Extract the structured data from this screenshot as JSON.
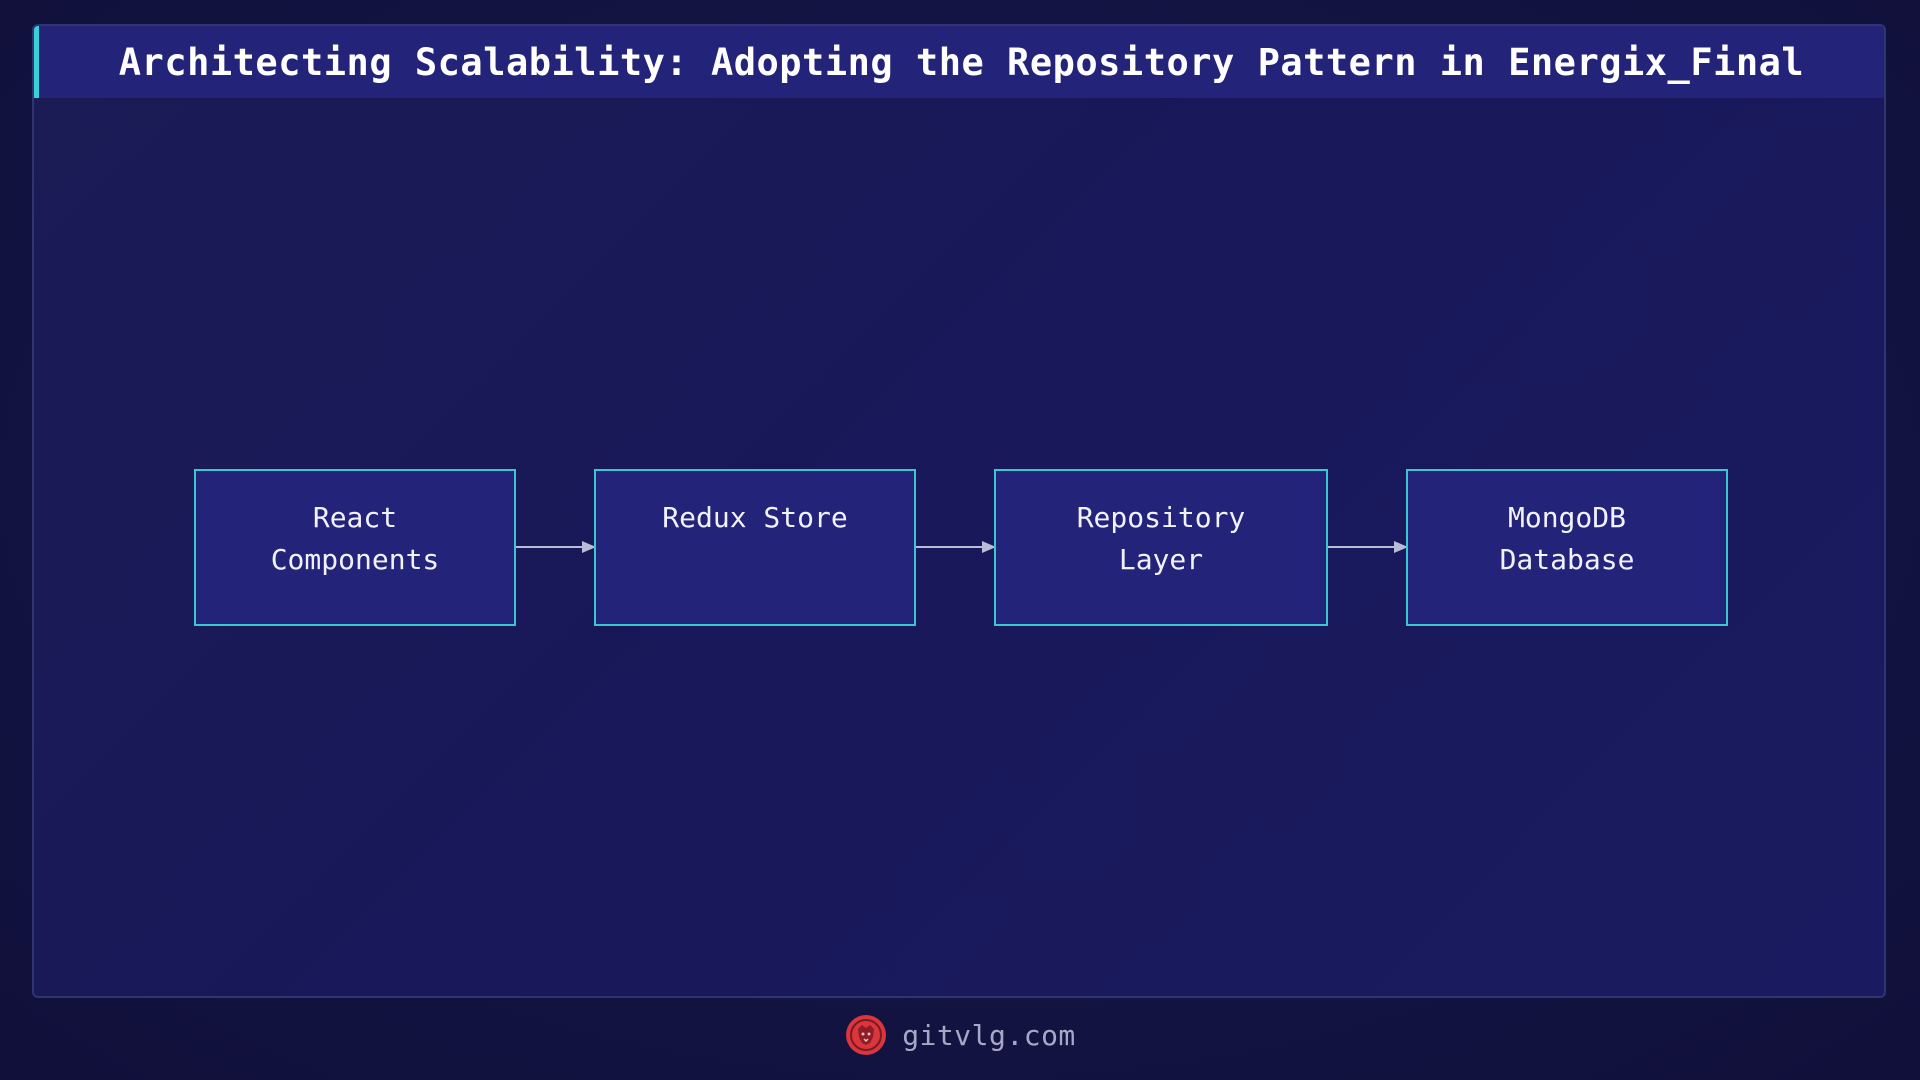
{
  "title": "Architecting Scalability: Adopting the Repository Pattern in Energix_Final",
  "diagram": {
    "nodes": [
      {
        "id": "react",
        "label": "React\nComponents"
      },
      {
        "id": "redux",
        "label": "Redux Store"
      },
      {
        "id": "repo",
        "label": "Repository\nLayer"
      },
      {
        "id": "mongo",
        "label": "MongoDB\nDatabase"
      }
    ],
    "edges": [
      {
        "from": "react",
        "to": "redux"
      },
      {
        "from": "redux",
        "to": "repo"
      },
      {
        "from": "repo",
        "to": "mongo"
      }
    ]
  },
  "footer": {
    "site": "gitvlg.com",
    "logo_icon": "lion-logo-icon"
  },
  "colors": {
    "background": "#121238",
    "title_bar": "#23237a",
    "accent": "#3ad0d8",
    "node_fill": "#23237a",
    "node_border": "#3ec6d0",
    "edge": "#b8bcd8",
    "logo": "#d9363e"
  }
}
